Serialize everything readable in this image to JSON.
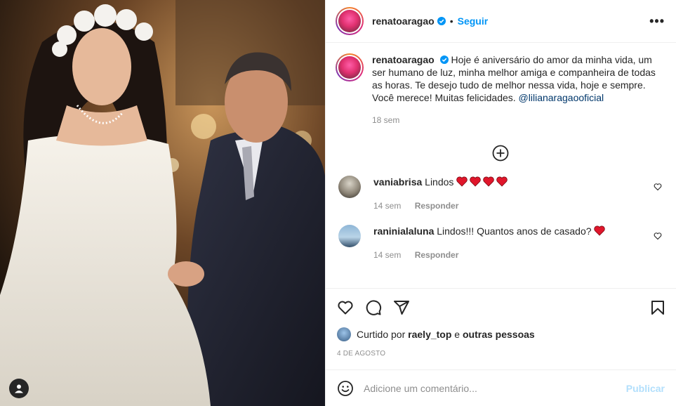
{
  "post": {
    "username": "renatoaragao",
    "follow_label": "Seguir",
    "separator": "•",
    "more_label": "•••"
  },
  "caption": {
    "username": "renatoaragao",
    "text": "Hoje é aniversário do amor da minha vida, um ser humano de luz, minha melhor amiga e companheira de todas as horas. Te desejo tudo de melhor nessa vida, hoje e sempre. Você merece! Muitas felicidades.",
    "mention": "@lilianaragaooficial",
    "time": "18 sem"
  },
  "comments": [
    {
      "username": "vaniabrisa",
      "text": "Lindos",
      "hearts": 4,
      "time": "14 sem",
      "reply_label": "Responder"
    },
    {
      "username": "raninialaluna",
      "text": "Lindos!!! Quantos anos de casado?",
      "hearts": 1,
      "time": "14 sem",
      "reply_label": "Responder"
    }
  ],
  "likes": {
    "prefix": "Curtido por",
    "user": "raely_top",
    "joiner": "e",
    "others": "outras pessoas"
  },
  "date": "4 DE AGOSTO",
  "add_comment": {
    "placeholder": "Adicione um comentário...",
    "publish_label": "Publicar"
  },
  "colors": {
    "accent": "#0095f6",
    "heart": "#ed4956",
    "publish_disabled": "#b2dffc"
  }
}
